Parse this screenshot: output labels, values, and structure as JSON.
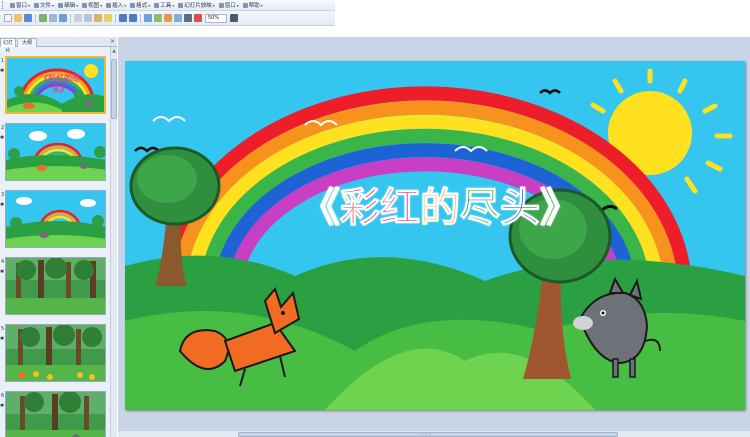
{
  "menubar": {
    "items": [
      {
        "label": "窗口",
        "icon": "window-icon"
      },
      {
        "label": "文件",
        "icon": "file-icon"
      },
      {
        "label": "编辑",
        "icon": "edit-icon"
      },
      {
        "label": "视图",
        "icon": "view-icon"
      },
      {
        "label": "插入",
        "icon": "insert-icon"
      },
      {
        "label": "格式",
        "icon": "format-icon"
      },
      {
        "label": "工具",
        "icon": "tools-icon"
      },
      {
        "label": "幻灯片放映",
        "icon": "slideshow-icon"
      },
      {
        "label": "窗口",
        "icon": "window-icon"
      },
      {
        "label": "帮助",
        "icon": "help-icon"
      }
    ]
  },
  "toolbar": {
    "zoom": "50%"
  },
  "panel": {
    "tabs": [
      {
        "label": "幻灯片"
      },
      {
        "label": "大纲"
      }
    ],
    "slides": [
      {
        "num": "1",
        "theme": "rainbow-title",
        "mini_title": "《彩虹的尽头》"
      },
      {
        "num": "2",
        "theme": "rainbow-clouds",
        "mini_title": ""
      },
      {
        "num": "3",
        "theme": "rainbow-hills",
        "mini_title": ""
      },
      {
        "num": "4",
        "theme": "forest",
        "mini_title": ""
      },
      {
        "num": "5",
        "theme": "forest-flowers",
        "mini_title": ""
      },
      {
        "num": "6",
        "theme": "forest-animals",
        "mini_title": ""
      }
    ]
  },
  "slide": {
    "title_chars": [
      {
        "ch": "《",
        "color": "#1a2f8c"
      },
      {
        "ch": "彩",
        "color": "#e8202a"
      },
      {
        "ch": "红",
        "color": "#e23f9c"
      },
      {
        "ch": "的",
        "color": "#f5a21c"
      },
      {
        "ch": "尽",
        "color": "#29a84a"
      },
      {
        "ch": "头",
        "color": "#1e5fd0"
      },
      {
        "ch": "》",
        "color": "#1a2f8c"
      }
    ]
  },
  "colors": {
    "sky": "#35c6f0",
    "grass_dark": "#2aa043",
    "grass_light": "#6ed34f",
    "sun": "#ffe11f",
    "fox": "#f26b23",
    "wolf": "#6e7278",
    "selection": "#f2b733"
  }
}
